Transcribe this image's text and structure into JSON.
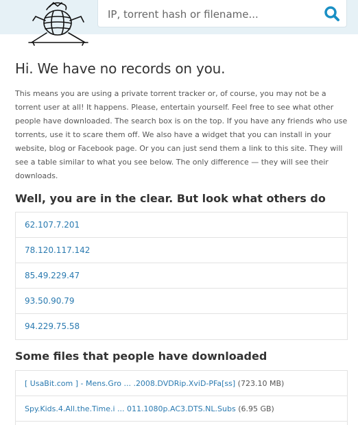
{
  "search": {
    "placeholder": "IP, torrent hash or filename..."
  },
  "heading": "Hi. We have no records on you.",
  "intro_text": "This means you are using a private torrent tracker or, of course, you may not be a torrent user at all! It happens. Please, entertain yourself. Feel free to see what other people have downloaded. The search box is on the top. If you have any friends who use torrents, use it to scare them off. We also have a widget that you can install in your website, blog or Facebook page. Or you can just send them a link to this site. They will see a table similar to what you see below. The only difference — they will see their downloads.",
  "ips_heading": "Well, you are in the clear. But look what others do",
  "ips": [
    "62.107.7.201",
    "78.120.117.142",
    "85.49.229.47",
    "93.50.90.79",
    "94.229.75.58"
  ],
  "files_heading": "Some files that people have downloaded",
  "files": [
    {
      "name": "[ UsaBit.com ] - Mens.Gro ... .2008.DVDRip.XviD-PFa[ss]",
      "size": "(723.10 MB)"
    },
    {
      "name": "Spy.Kids.4.All.the.Time.i ... 011.1080p.AC3.DTS.NL.Subs",
      "size": "(6.95 GB)"
    }
  ],
  "colors": {
    "topbar": "#e6f1f6",
    "link": "#2a7ab0",
    "search_icon": "#1a8fc4"
  }
}
